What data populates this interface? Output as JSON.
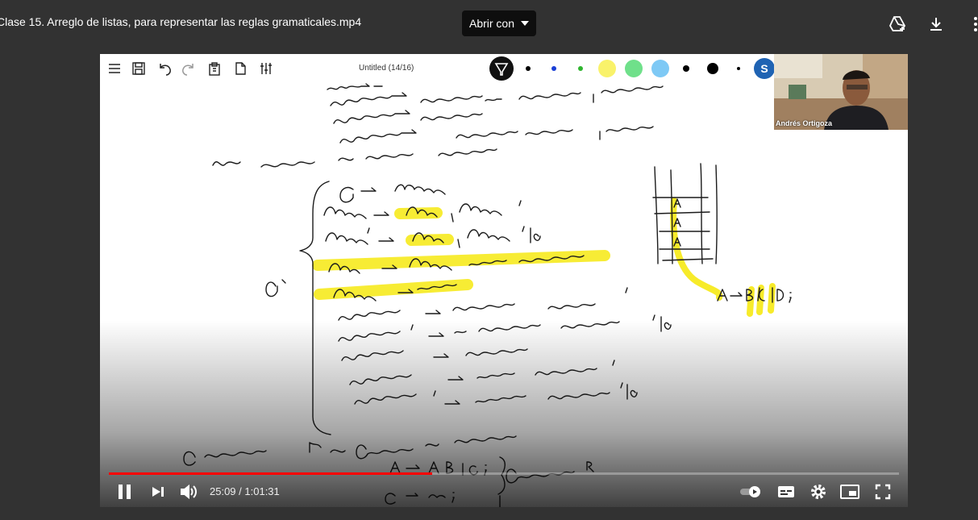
{
  "topbar": {
    "file_title": "Clase 15. Arreglo de listas, para representar las reglas gramaticales.mp4",
    "open_with": "Abrir con"
  },
  "whiteboard": {
    "title": "Untitled (14/16)",
    "user_initial": "S",
    "presenter_name": "Andrés Ortigoza",
    "colors": [
      "#000000",
      "#1a3fd6",
      "#2fb52f",
      "#f9f26a",
      "#6fe08a",
      "#7ec9f5",
      "#000000",
      "#000000",
      "#000000"
    ]
  },
  "player": {
    "current_time": "25:09",
    "separator": " / ",
    "duration": "1:01:31",
    "progress": 0.409,
    "accent": "#ff0000"
  }
}
